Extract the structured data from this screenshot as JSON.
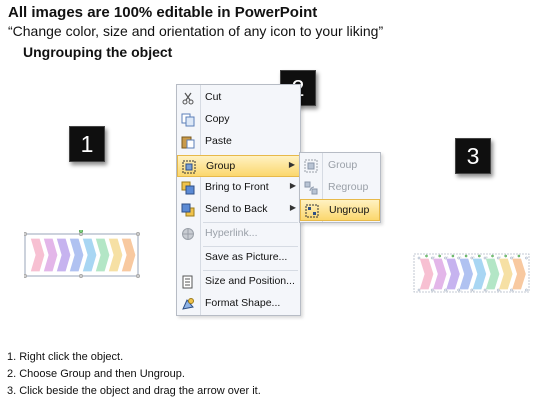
{
  "header": {
    "title": "All images are 100% editable in PowerPoint",
    "subtitle": "“Change color, size and orientation of any icon to your liking”",
    "section": "Ungrouping the object"
  },
  "steps_badges": [
    "1",
    "2",
    "3"
  ],
  "context_menu": {
    "items": [
      {
        "label": "Cut",
        "icon": "scissors-icon"
      },
      {
        "label": "Copy",
        "icon": "copy-icon"
      },
      {
        "label": "Paste",
        "icon": "paste-icon"
      },
      {
        "label": "Group",
        "icon": "group-icon",
        "highlighted": true,
        "submenu": true
      },
      {
        "label": "Bring to Front",
        "icon": "bring-front-icon",
        "submenu": true
      },
      {
        "label": "Send to Back",
        "icon": "send-back-icon",
        "submenu": true
      },
      {
        "label": "Hyperlink...",
        "icon": "hyperlink-icon",
        "disabled": true
      },
      {
        "label": "Save as Picture...",
        "icon": ""
      },
      {
        "label": "Size and Position...",
        "icon": "size-icon"
      },
      {
        "label": "Format Shape...",
        "icon": "format-shape-icon"
      }
    ],
    "submenu_items": [
      {
        "label": "Group",
        "icon": "group-icon",
        "disabled": true
      },
      {
        "label": "Regroup",
        "icon": "regroup-icon",
        "disabled": true
      },
      {
        "label": "Ungroup",
        "icon": "ungroup-icon",
        "highlighted": true
      }
    ]
  },
  "chevron_colors": [
    "#f7c0d2",
    "#e3b6e9",
    "#c6b3ef",
    "#b0c2f1",
    "#a8d6f3",
    "#b3e6c6",
    "#f6e0a4",
    "#f8c9a0"
  ],
  "instructions": [
    "1.  Right click the object.",
    "2.  Choose Group and then Ungroup.",
    "3.  Click beside the object and drag the arrow over it."
  ],
  "colors": {
    "highlight": "#fbd76e",
    "badge": "#0f0f0f"
  }
}
